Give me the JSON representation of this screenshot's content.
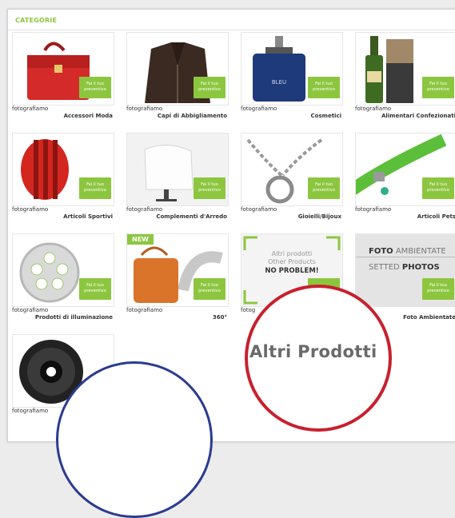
{
  "section": {
    "title": "CATEGORIE"
  },
  "badge_text": "Fai il tuo preventivo",
  "cards": [
    {
      "cap1": "fotografiamo",
      "cap2": "Accessori Moda"
    },
    {
      "cap1": "fotografiamo",
      "cap2": "Capi di Abbigliamento"
    },
    {
      "cap1": "fotografiamo",
      "cap2": "Cosmetici"
    },
    {
      "cap1": "fotografiamo",
      "cap2": "Alimentari Confezionati"
    },
    {
      "cap1": "fotografiamo",
      "cap2": "Articoli Sportivi"
    },
    {
      "cap1": "fotografiamo",
      "cap2": "Complementi d'Arredo"
    },
    {
      "cap1": "fotografiamo",
      "cap2": "Gioielli/Bijoux"
    },
    {
      "cap1": "fotografiamo",
      "cap2": "Articoli Pets"
    },
    {
      "cap1": "fotografiamo",
      "cap2": "Prodotti di illuminazione"
    },
    {
      "cap1": "fotografiamo",
      "cap2": "360°",
      "tag": "NEW"
    },
    {
      "cap1": "fotog",
      "cap2": "",
      "thumb_text": {
        "l1": "Altri prodotti",
        "l2": "Other Products",
        "l3": "NO PROBLEM!"
      }
    },
    {
      "cap1": "fiamo",
      "cap2": "Foto Ambientate",
      "thumb_text": {
        "l1a": "FOTO",
        "l1b": "AMBIENTATE",
        "l2a": "SETTED",
        "l2b": "PHOTOS"
      }
    },
    {
      "cap1": "fotografiamo",
      "cap2": ""
    }
  ],
  "overlay_label": "Altri Prodotti",
  "colors": {
    "accent": "#8cc63f",
    "red_circle": "#c8202e",
    "blue_circle": "#2a3b8f"
  }
}
